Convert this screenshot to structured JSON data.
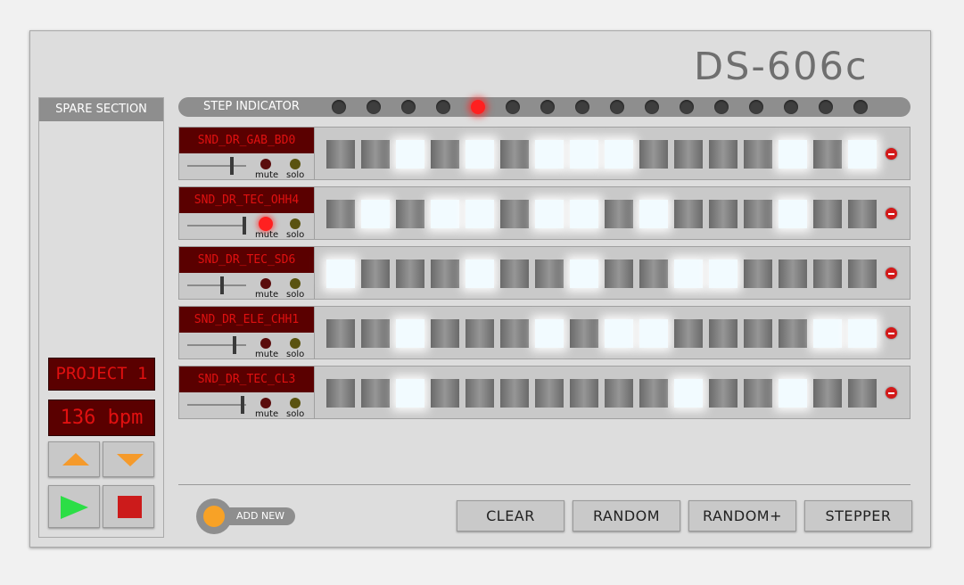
{
  "app": {
    "brand": "DS-606c"
  },
  "spare_section": {
    "title": "SPARE SECTION"
  },
  "transport": {
    "project": "PROJECT 1",
    "tempo": "136 bpm"
  },
  "step_indicator": {
    "label": "STEP INDICATOR",
    "total_steps": 16,
    "current_step": 5
  },
  "tracks": [
    {
      "name": "SND_DR_GAB_BD0",
      "volume": 0.75,
      "mute": false,
      "solo": false,
      "steps": [
        0,
        0,
        1,
        0,
        1,
        0,
        1,
        1,
        1,
        0,
        0,
        0,
        0,
        1,
        0,
        1
      ]
    },
    {
      "name": "SND_DR_TEC_OHH4",
      "volume": 0.97,
      "mute": true,
      "solo": false,
      "steps": [
        0,
        1,
        0,
        1,
        1,
        0,
        1,
        1,
        0,
        1,
        0,
        0,
        0,
        1,
        0,
        0
      ]
    },
    {
      "name": "SND_DR_TEC_SD6",
      "volume": 0.58,
      "mute": false,
      "solo": false,
      "steps": [
        1,
        0,
        0,
        0,
        1,
        0,
        0,
        1,
        0,
        0,
        1,
        1,
        0,
        0,
        0,
        0
      ]
    },
    {
      "name": "SND_DR_ELE_CHH1",
      "volume": 0.8,
      "mute": false,
      "solo": false,
      "steps": [
        0,
        0,
        1,
        0,
        0,
        0,
        1,
        0,
        1,
        1,
        0,
        0,
        0,
        0,
        1,
        1
      ]
    },
    {
      "name": "SND_DR_TEC_CL3",
      "volume": 0.93,
      "mute": false,
      "solo": false,
      "steps": [
        0,
        0,
        1,
        0,
        0,
        0,
        0,
        0,
        0,
        0,
        1,
        0,
        0,
        1,
        0,
        0
      ]
    }
  ],
  "labels": {
    "mute": "mute",
    "solo": "solo",
    "add_new": "ADD NEW"
  },
  "actions": {
    "clear": "CLEAR",
    "random": "RANDOM",
    "random_plus": "RANDOM+",
    "stepper": "STEPPER"
  },
  "colors": {
    "lcd_bg": "#5a0000",
    "lcd_text": "#e01010",
    "accent_orange": "#f59a2b",
    "play_green": "#2cde46",
    "stop_red": "#cc1b1b",
    "led_active": "#ff2020"
  }
}
